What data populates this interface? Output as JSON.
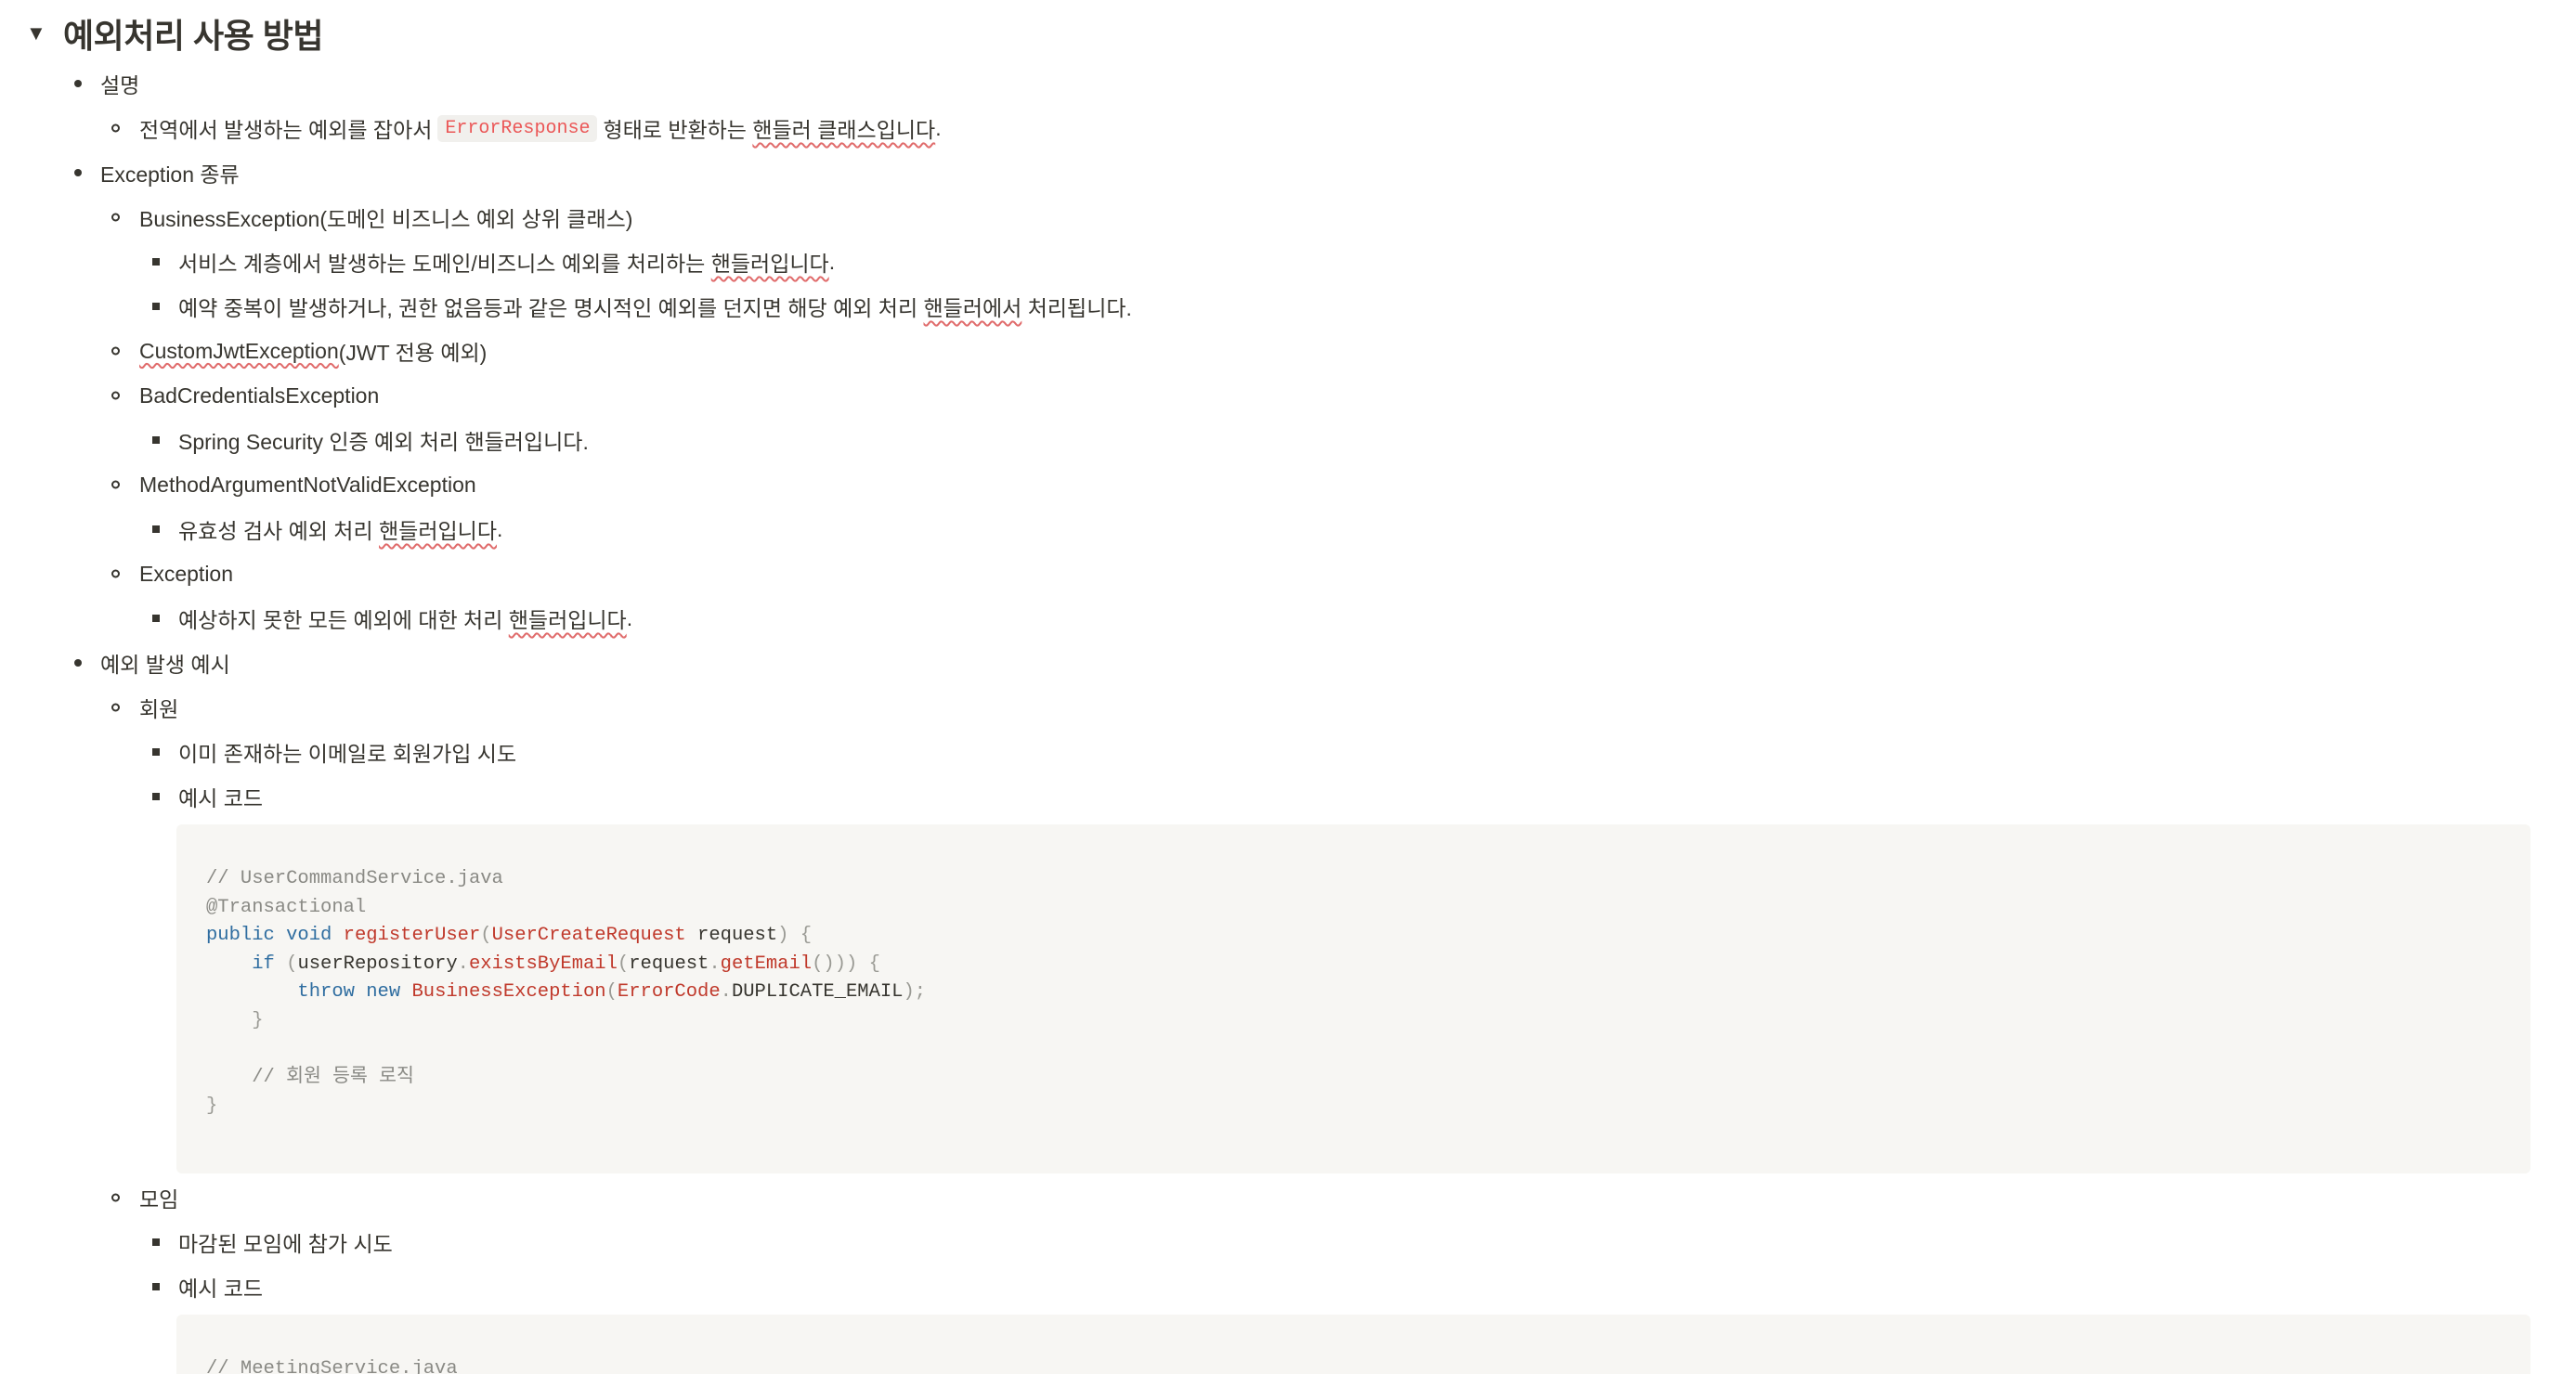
{
  "section": {
    "arrow": "▼",
    "title": "예외처리 사용 방법"
  },
  "desc": {
    "label": "설명",
    "line_pre": "전역에서 발생하는 예외를 잡아서",
    "inline_code": "ErrorResponse",
    "line_mid": "형태로 반환하는",
    "line_spell": "핸들러 클래스입니다",
    "line_end": "."
  },
  "types": {
    "label": "Exception 종류",
    "business": {
      "title": "BusinessException(도메인 비즈니스 예외 상위 클래스)",
      "sub1_pre": "서비스 계층에서 발생하는 도메인/비즈니스 예외를 처리하는",
      "sub1_spell": "핸들러입니다",
      "sub1_end": ".",
      "sub2_pre": "예약 중복이 발생하거나, 권한 없음등과 같은 명시적인 예외를 던지면 해당 예외 처리",
      "sub2_spell": "핸들러에서",
      "sub2_end": "처리됩니다."
    },
    "jwt": {
      "spell": "CustomJwtException",
      "rest": "(JWT 전용 예외)"
    },
    "bad": {
      "title": "BadCredentialsException",
      "sub": "Spring Security 인증 예외 처리 핸들러입니다."
    },
    "method": {
      "title": "MethodArgumentNotValidException",
      "sub_pre": "유효성 검사 예외 처리",
      "sub_spell": "핸들러입니다",
      "sub_end": "."
    },
    "exception": {
      "title": "Exception",
      "sub_pre": "예상하지 못한 모든 예외에 대한 처리",
      "sub_spell": "핸들러입니다",
      "sub_end": "."
    }
  },
  "examples": {
    "label": "예외 발생 예시",
    "member": {
      "title": "회원",
      "sub1": "이미 존재하는 이메일로 회원가입 시도",
      "sub2": "예시 코드",
      "code": {
        "l1": "// UserCommandService.java",
        "l2": "@Transactional",
        "l3_kw1": "public",
        "l3_kw2": "void",
        "l3_fn": "registerUser",
        "l3_p1": "(",
        "l3_type": "UserCreateRequest",
        "l3_arg": " request",
        "l3_p2": ") {",
        "l4_kw": "if",
        "l4_p1": " (",
        "l4_obj": "userRepository",
        "l4_dot": ".",
        "l4_fn": "existsByEmail",
        "l4_p2": "(",
        "l4_arg": "request",
        "l4_dot2": ".",
        "l4_fn2": "getEmail",
        "l4_p3": "())) {",
        "l5_kw1": "throw",
        "l5_kw2": "new",
        "l5_type": "BusinessException",
        "l5_p1": "(",
        "l5_type2": "ErrorCode",
        "l5_dot": ".",
        "l5_const": "DUPLICATE_EMAIL",
        "l5_p2": ");",
        "l6": "}",
        "l8": "// 회원 등록 로직",
        "l9": "}"
      }
    },
    "meeting": {
      "title": "모임",
      "sub1": "마감된 모임에 참가 시도",
      "sub2": "예시 코드",
      "code_l1": "// MeetingService.java"
    }
  }
}
